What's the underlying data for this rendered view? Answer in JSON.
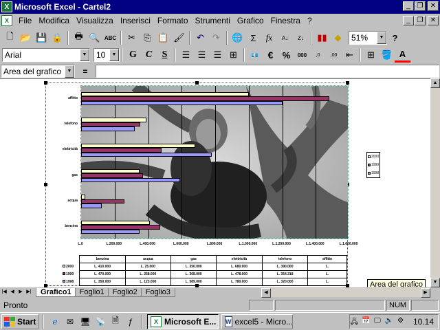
{
  "window": {
    "title": "Microsoft Excel - Cartel2",
    "app_icon": "excel-icon"
  },
  "menu": {
    "items": [
      "File",
      "Modifica",
      "Visualizza",
      "Inserisci",
      "Formato",
      "Strumenti",
      "Grafico",
      "Finestra",
      "?"
    ]
  },
  "toolbar": {
    "zoom": "51%",
    "help_glyph": "?"
  },
  "format_toolbar": {
    "font": "Arial",
    "size": "10",
    "bold": "G",
    "italic": "C",
    "underline": "S",
    "euro": "€",
    "percent": "%",
    "font_color_glyph": "A"
  },
  "formula_bar": {
    "name_box": "Area del grafico",
    "equals": "=",
    "value": ""
  },
  "chart_data": {
    "type": "bar",
    "orientation": "horizontal",
    "categories": [
      "benzina",
      "acqua",
      "gas",
      "elettricità",
      "telefono",
      "affitto"
    ],
    "series": [
      {
        "name": "2000",
        "values": [
          410000,
          25000,
          350000,
          680000,
          390000,
          1000000
        ],
        "color": "#ffffcc"
      },
      {
        "name": "1999",
        "values": [
          470000,
          258000,
          368000,
          478000,
          354318,
          1480000
        ],
        "color": "#993366"
      },
      {
        "name": "1998",
        "values": [
          350000,
          123000,
          589000,
          780000,
          320000,
          1200000
        ],
        "color": "#9999ff"
      }
    ],
    "xlim": [
      0,
      1600000
    ],
    "x_ticks": [
      "L.0",
      "L.200.000",
      "L.400.000",
      "L.600.000",
      "L.800.000",
      "L.1.000.000",
      "L.1.200.000",
      "L.1.400.000",
      "L.1.600.000"
    ],
    "legend_position": "right",
    "grid": "vertical",
    "data_table": {
      "headers": [
        "benzina",
        "acqua",
        "gas",
        "elettricità",
        "telefono",
        "affitto"
      ],
      "rows": [
        {
          "name": "2000",
          "cells": [
            "L. 410.000",
            "L. 25.000",
            "L. 350.000",
            "L. 680.000",
            "L. 390.000",
            "L."
          ]
        },
        {
          "name": "1999",
          "cells": [
            "L. 470.000",
            "L. 258.000",
            "L. 368.000",
            "L. 478.000",
            "L. 354.318",
            "L."
          ]
        },
        {
          "name": "1998",
          "cells": [
            "L. 350.000",
            "L. 123.000",
            "L. 589.000",
            "L. 780.000",
            "L. 320.000",
            "L."
          ]
        }
      ]
    }
  },
  "tooltip": "Area del grafico",
  "sheets": [
    "Grafico1",
    "Foglio1",
    "Foglio2",
    "Foglio3"
  ],
  "active_sheet": "Grafico1",
  "status": {
    "text": "Pronto",
    "num": "NUM"
  },
  "taskbar": {
    "start": "Start",
    "tasks": [
      {
        "label": "Microsoft E...",
        "active": true
      },
      {
        "label": "excel5 - Micro...",
        "active": false
      }
    ],
    "clock": "10.14"
  }
}
